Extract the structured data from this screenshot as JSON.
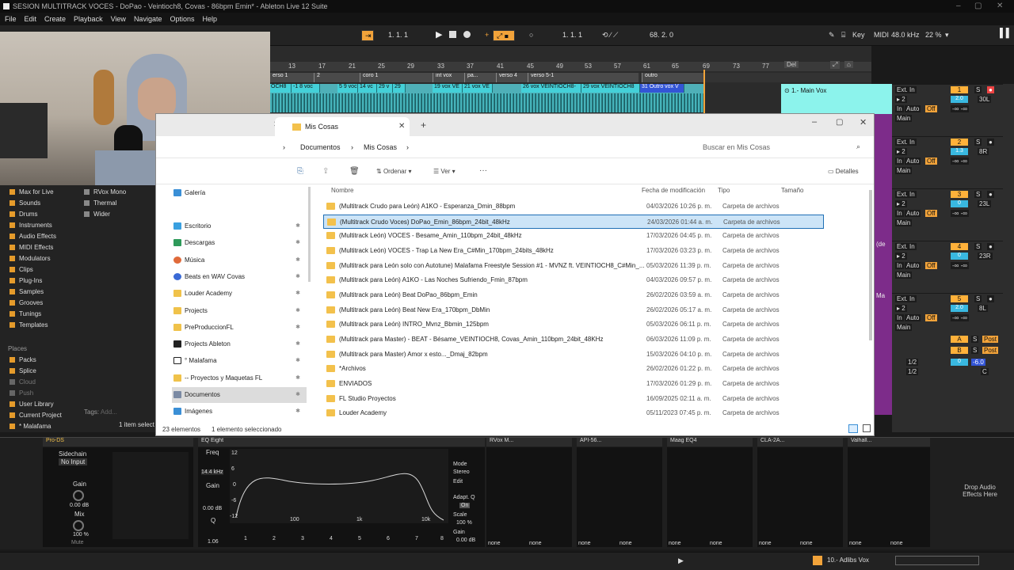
{
  "title": "SESION MULTITRACK VOCES - DoPao - Veintioch8, Covas - 86bpm Emin* - Ableton Live 12 Suite",
  "menu": [
    "File",
    "Edit",
    "Create",
    "Playback",
    "View",
    "Navigate",
    "Options",
    "Help"
  ],
  "transport": {
    "position": "1.   1.   1",
    "loop_start": "1.   1.   1",
    "loop_length": "68.   2.   0",
    "key": "Key",
    "midi": "MIDI",
    "sample_rate": "48.0 kHz",
    "cpu": "22 %"
  },
  "ruler": [
    "13",
    "17",
    "21",
    "25",
    "29",
    "33",
    "37",
    "41",
    "45",
    "49",
    "53",
    "57",
    "61",
    "65",
    "69",
    "73",
    "77"
  ],
  "locators": [
    "erso 1",
    "2",
    "coro 1",
    "int vox",
    "pa...",
    "verso 4",
    "verso 5-1",
    "outro"
  ],
  "clips": [
    "OCH8",
    "-1 8 voc",
    "5 9 voc",
    "14 vc",
    "29 v",
    "29",
    "19 vox VE",
    "21 vox VE",
    "26 vox VEINTIOCH8-",
    "29 vox VEINTIOCH8",
    "31 Outro vox V"
  ],
  "arrange_del": "Del",
  "main_vox_label": "1.- Main Vox",
  "mixer": {
    "ext_in": "Ext. In",
    "main": "Main",
    "auto": "Auto",
    "off": "Off",
    "in": "In",
    "tracks": [
      {
        "num": "1",
        "val": "2.0",
        "pan": "30L"
      },
      {
        "num": "2",
        "val": "1.3",
        "pan": "8R"
      },
      {
        "num": "3",
        "val": "0",
        "pan": "23L"
      },
      {
        "num": "4",
        "val": "0",
        "pan": "23R"
      },
      {
        "num": "5",
        "val": "2.0",
        "pan": "8L"
      }
    ],
    "returns": [
      {
        "label": "A",
        "post": "Post"
      },
      {
        "label": "B",
        "post": "Post"
      }
    ],
    "master": {
      "label": "1/2",
      "val": "0",
      "db": "-6.0",
      "pan": "C"
    },
    "side_labels": [
      "(de",
      "Ma"
    ]
  },
  "browser": {
    "collections": [
      "Max for Live",
      "Sounds",
      "Drums",
      "Instruments",
      "Audio Effects",
      "MIDI Effects",
      "Modulators",
      "Clips",
      "Plug-Ins",
      "Samples",
      "Grooves",
      "Tunings",
      "Templates"
    ],
    "places_header": "Places",
    "places": [
      "Packs",
      "Splice",
      "Cloud",
      "Push",
      "User Library",
      "Current Project",
      "* Malafama"
    ],
    "right": [
      "RVox Mono",
      "Thermal",
      "Wider"
    ],
    "tags": "Tags:",
    "tags_add": "Add...",
    "selected_info": "1 item select"
  },
  "explorer": {
    "tab": "Mis Cosas",
    "breadcrumb": [
      "Documentos",
      "Mis Cosas"
    ],
    "search_placeholder": "Buscar en Mis Cosas",
    "toolbar": {
      "sort": "Ordenar",
      "view": "Ver",
      "more": "···",
      "details": "Detalles"
    },
    "nav": [
      {
        "name": "Galería",
        "pin": false
      },
      {
        "name": "Escritorio",
        "pin": true
      },
      {
        "name": "Descargas",
        "pin": true
      },
      {
        "name": "Música",
        "pin": true
      },
      {
        "name": "Beats en WAV Covas",
        "pin": true
      },
      {
        "name": "Louder Academy",
        "pin": true
      },
      {
        "name": "Projects",
        "pin": true
      },
      {
        "name": "PreProduccionFL",
        "pin": true
      },
      {
        "name": "Projects Ableton",
        "pin": true
      },
      {
        "name": "° Malafama",
        "pin": true
      },
      {
        "name": "-- Proyectos y Maquetas FL",
        "pin": true
      },
      {
        "name": "Documentos",
        "pin": true
      },
      {
        "name": "Imágenes",
        "pin": true
      }
    ],
    "columns": {
      "name": "Nombre",
      "date": "Fecha de modificación",
      "type": "Tipo",
      "size": "Tamaño"
    },
    "files": [
      {
        "name": "(Multitrack Crudo para León) A1KO - Esperanza_Dmin_88bpm",
        "date": "04/03/2026 10:26 p. m.",
        "type": "Carpeta de archivos"
      },
      {
        "name": "(Multitrack Crudo Voces) DoPao_Emin_86bpm_24bit_48kHz",
        "date": "24/03/2026 01:44 a. m.",
        "type": "Carpeta de archivos",
        "selected": true
      },
      {
        "name": "(Multitrack León) VOCES - Besame_Amin_110bpm_24bit_48kHz",
        "date": "17/03/2026 04:45 p. m.",
        "type": "Carpeta de archivos"
      },
      {
        "name": "(Multitrack León) VOCES - Trap La New Era_C#Min_170bpm_24bits_48kHz",
        "date": "17/03/2026 03:23 p. m.",
        "type": "Carpeta de archivos"
      },
      {
        "name": "(Multitrack para León solo con Autotune) Malafama Freestyle Session #1 - MVNZ ft. VEINTIOCH8_C#Min_...",
        "date": "05/03/2026 11:39 p. m.",
        "type": "Carpeta de archivos"
      },
      {
        "name": "(Multitrack para León) A1KO - Las Noches Sufriendo_Fmin_87bpm",
        "date": "04/03/2026 09:57 p. m.",
        "type": "Carpeta de archivos"
      },
      {
        "name": "(Multitrack para León) Beat DoPao_86bpm_Emin",
        "date": "26/02/2026 03:59 a. m.",
        "type": "Carpeta de archivos"
      },
      {
        "name": "(Multitrack para León) Beat New Era_170bpm_DbMin",
        "date": "26/02/2026 05:17 a. m.",
        "type": "Carpeta de archivos"
      },
      {
        "name": "(Multitrack para León) INTRO_Mvnz_Bbmin_125bpm",
        "date": "05/03/2026 06:11 p. m.",
        "type": "Carpeta de archivos"
      },
      {
        "name": "(Multitrack para Master) - BEAT - Bésame_VEINTIOCH8, Covas_Amin_110bpm_24bit_48KHz",
        "date": "06/03/2026 11:09 p. m.",
        "type": "Carpeta de archivos"
      },
      {
        "name": "(Multitrack para Master) Amor x esto..._Dmaj_82bpm",
        "date": "15/03/2026 04:10 p. m.",
        "type": "Carpeta de archivos"
      },
      {
        "name": "*Archivos",
        "date": "26/02/2026 01:22 p. m.",
        "type": "Carpeta de archivos"
      },
      {
        "name": "ENVIADOS",
        "date": "17/03/2026 01:29 p. m.",
        "type": "Carpeta de archivos"
      },
      {
        "name": "FL Studio Proyectos",
        "date": "16/09/2025 02:11 a. m.",
        "type": "Carpeta de archivos"
      },
      {
        "name": "Louder Academy",
        "date": "05/11/2023 07:45 p. m.",
        "type": "Carpeta de archivos"
      }
    ],
    "status_count": "23 elementos",
    "status_selected": "1 elemento seleccionado"
  },
  "devices": {
    "pro_ds": "Pro-DS",
    "sidechain": "Sidechain",
    "no_input": "No Input",
    "gain_label": "Gain",
    "gain_val": "0.00 dB",
    "mix_label": "Mix",
    "mix_val": "100 %",
    "mute": "Mute",
    "eq": "EQ Eight",
    "freq_label": "Freq",
    "freq_val": "14.4 kHz",
    "eq_gain_label": "Gain",
    "eq_gain_val": "0.00 dB",
    "q_label": "Q",
    "q_val": "1.06",
    "eq_axis_y": [
      "12",
      "6",
      "0",
      "-6",
      "-12"
    ],
    "eq_axis_x": [
      "100",
      "1k",
      "10k"
    ],
    "eq_bands": [
      "1",
      "2",
      "3",
      "4",
      "5",
      "6",
      "7",
      "8"
    ],
    "mode_label": "Mode",
    "mode_val": "Stereo",
    "edit": "Edit",
    "adapt_q": "Adapt. Q",
    "on": "On",
    "scale_label": "Scale",
    "scale_val": "100 %",
    "out_gain_label": "Gain",
    "out_gain_val": "0.00 dB",
    "plugins": [
      "RVox M...",
      "API-56...",
      "Maag EQ4",
      "CLA-2A...",
      "Valhall..."
    ],
    "none": "none",
    "drop_text": "Drop Audio Effects Here"
  },
  "bottom": {
    "track_label": "10.- Adlibs Vox"
  }
}
